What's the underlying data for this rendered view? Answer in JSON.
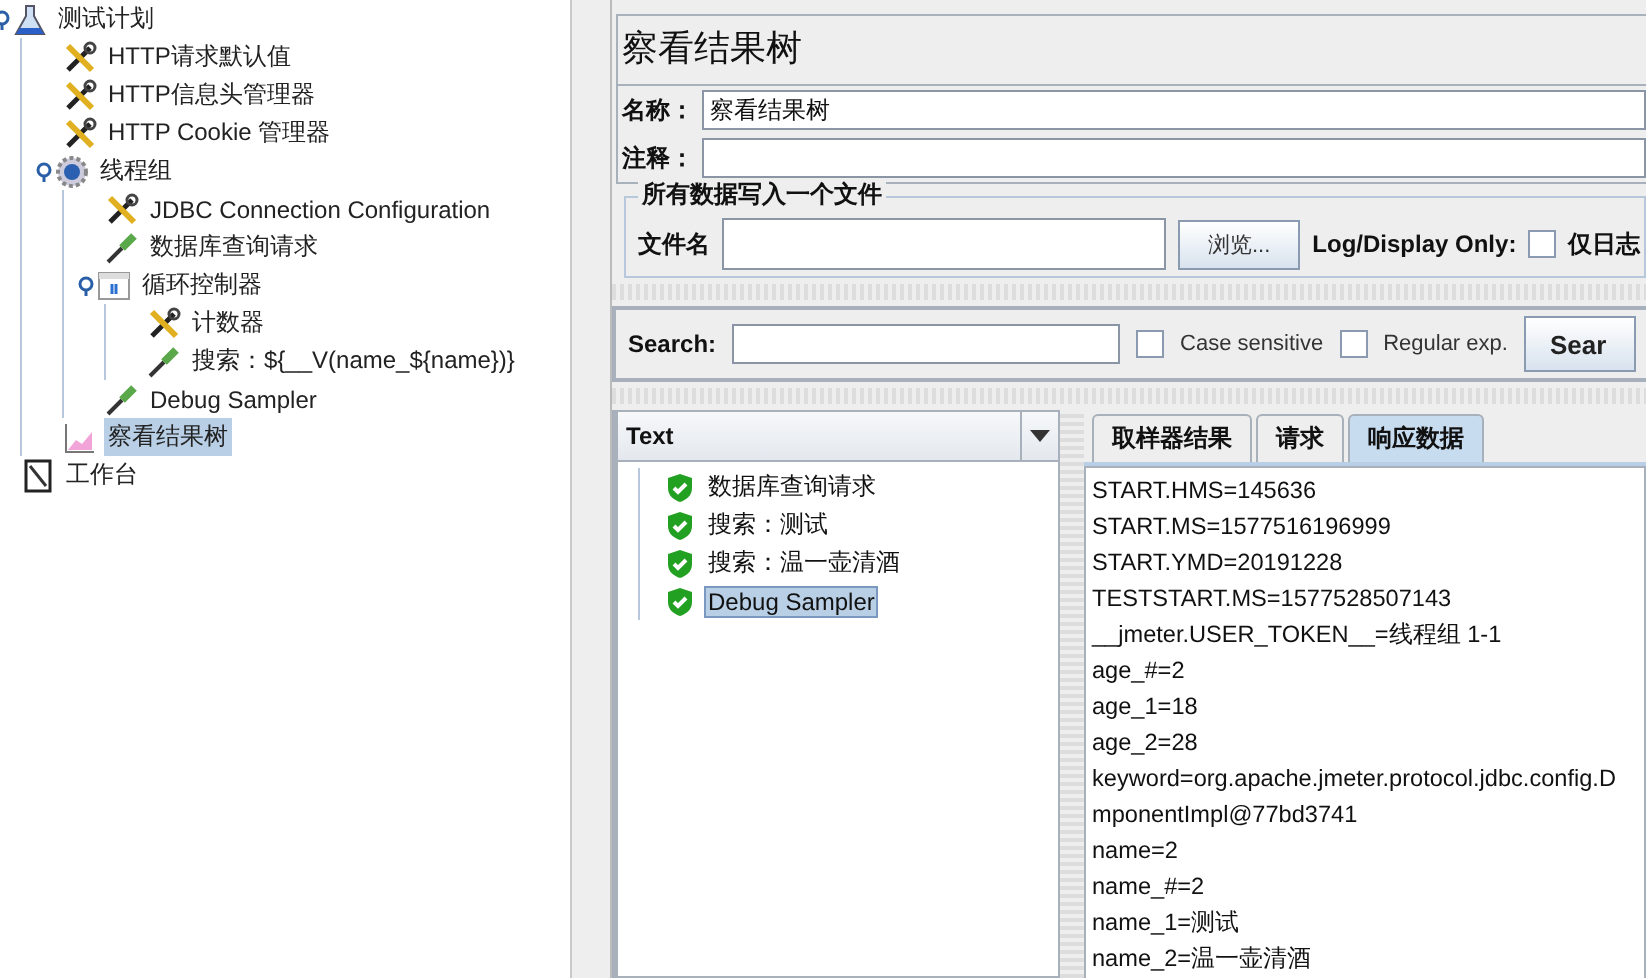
{
  "tree": [
    {
      "label": "测试计划",
      "kind": "flask",
      "selected": false,
      "children": [
        {
          "label": "HTTP请求默认值",
          "kind": "wrench",
          "selected": false
        },
        {
          "label": "HTTP信息头管理器",
          "kind": "wrench",
          "selected": false
        },
        {
          "label": "HTTP Cookie 管理器",
          "kind": "wrench",
          "selected": false
        },
        {
          "label": "线程组",
          "kind": "gear",
          "selected": false,
          "children": [
            {
              "label": "JDBC Connection Configuration",
              "kind": "wrench",
              "selected": false
            },
            {
              "label": "数据库查询请求",
              "kind": "dropper",
              "selected": false
            },
            {
              "label": "循环控制器",
              "kind": "loop",
              "selected": false,
              "children": [
                {
                  "label": "计数器",
                  "kind": "wrench",
                  "selected": false
                },
                {
                  "label": "搜索：${__V(name_${name})}",
                  "kind": "dropper",
                  "selected": false
                }
              ]
            },
            {
              "label": "Debug Sampler",
              "kind": "dropper",
              "selected": false
            }
          ]
        },
        {
          "label": "察看结果树",
          "kind": "graph",
          "selected": true
        }
      ]
    },
    {
      "label": "工作台",
      "kind": "notebook",
      "selected": false
    }
  ],
  "panel": {
    "title": "察看结果树",
    "name_label": "名称：",
    "name_value": "察看结果树",
    "comment_label": "注释：",
    "file_group": {
      "title": "所有数据写入一个文件",
      "file_label": "文件名",
      "browse_button": "浏览...",
      "log_label": "Log/Display Only:",
      "errors_checkbox": {
        "label": "仅日志",
        "checked": false
      }
    },
    "search": {
      "label": "Search:",
      "case_sensitive": {
        "label": "Case sensitive",
        "checked": false
      },
      "regex": {
        "label": "Regular exp.",
        "checked": false
      },
      "button": "Sear"
    },
    "results": {
      "renderer": "Text",
      "samples": [
        {
          "label": "数据库查询请求",
          "success": true,
          "selected": false
        },
        {
          "label": "搜索：测试",
          "success": true,
          "selected": false
        },
        {
          "label": "搜索：温一壶清酒",
          "success": true,
          "selected": false
        },
        {
          "label": "Debug Sampler",
          "success": true,
          "selected": true
        }
      ],
      "tabs": [
        {
          "label": "取样器结果",
          "selected": false
        },
        {
          "label": "请求",
          "selected": false
        },
        {
          "label": "响应数据",
          "selected": true
        }
      ],
      "response_lines": [
        "START.HMS=145636",
        "START.MS=1577516196999",
        "START.YMD=20191228",
        "TESTSTART.MS=1577528507143",
        "__jmeter.USER_TOKEN__=线程组 1-1",
        "age_#=2",
        "age_1=18",
        "age_2=28",
        "keyword=org.apache.jmeter.protocol.jdbc.config.D",
        "mponentImpl@77bd3741",
        "name=2",
        "name_#=2",
        "name_1=测试",
        "name_2=温一壶清酒"
      ]
    }
  }
}
